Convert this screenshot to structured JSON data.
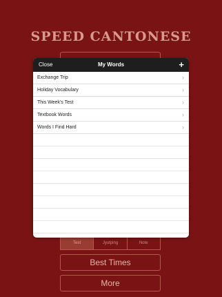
{
  "app": {
    "title": "SPEED CANTONESE"
  },
  "background_buttons": {
    "top_label": "",
    "segments": [
      "Test",
      "Jyutping",
      "Note"
    ],
    "best_times_label": "Best Times",
    "more_label": "More"
  },
  "modal": {
    "close_label": "Close",
    "title": "My Words",
    "add_label": "+",
    "items": [
      {
        "label": "Exchange Trip",
        "chevron": "›"
      },
      {
        "label": "Holiday Vocabulary",
        "chevron": "›"
      },
      {
        "label": "This Week's Test",
        "chevron": "›"
      },
      {
        "label": "Textbook Words",
        "chevron": "›"
      },
      {
        "label": "Words I Find Hard",
        "chevron": "›"
      }
    ]
  },
  "colors": {
    "background": "#7a1414",
    "modal_header": "#1e1e1e"
  }
}
